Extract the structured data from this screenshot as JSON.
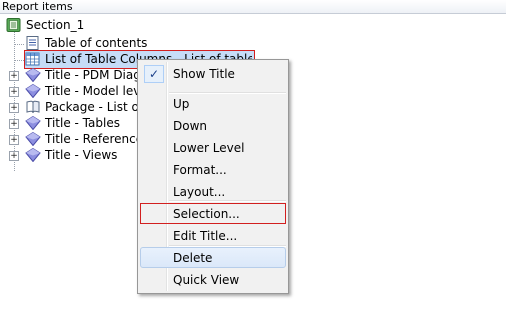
{
  "panel": {
    "title": "Report items"
  },
  "tree": {
    "root": {
      "label": "Section_1",
      "icon": "section-icon"
    },
    "items": [
      {
        "label": "Table of contents",
        "icon": "document-icon"
      },
      {
        "label": "List of Table Columns - List of table columns",
        "icon": "table-list-icon"
      },
      {
        "label": "Title - PDM Diagrams",
        "icon": "gem-icon"
      },
      {
        "label": "Title - Model level ob",
        "icon": "gem-icon"
      },
      {
        "label": "Package - List of ob",
        "icon": "package-book-icon"
      },
      {
        "label": "Title - Tables",
        "icon": "gem-icon"
      },
      {
        "label": "Title - References",
        "icon": "gem-icon"
      },
      {
        "label": "Title - Views",
        "icon": "gem-icon"
      }
    ]
  },
  "context_menu": {
    "items": [
      {
        "label": "Show Title",
        "checked": true
      },
      {
        "label": "Up"
      },
      {
        "label": "Down"
      },
      {
        "label": "Lower Level"
      },
      {
        "label": "Format..."
      },
      {
        "label": "Layout..."
      },
      {
        "label": "Selection..."
      },
      {
        "label": "Edit Title..."
      },
      {
        "label": "Delete"
      },
      {
        "label": "Quick View"
      }
    ]
  },
  "colors": {
    "selection_highlight": "#c6dcf7",
    "callout_border": "#d21f1f",
    "menu_bg": "#f1f1f1"
  }
}
